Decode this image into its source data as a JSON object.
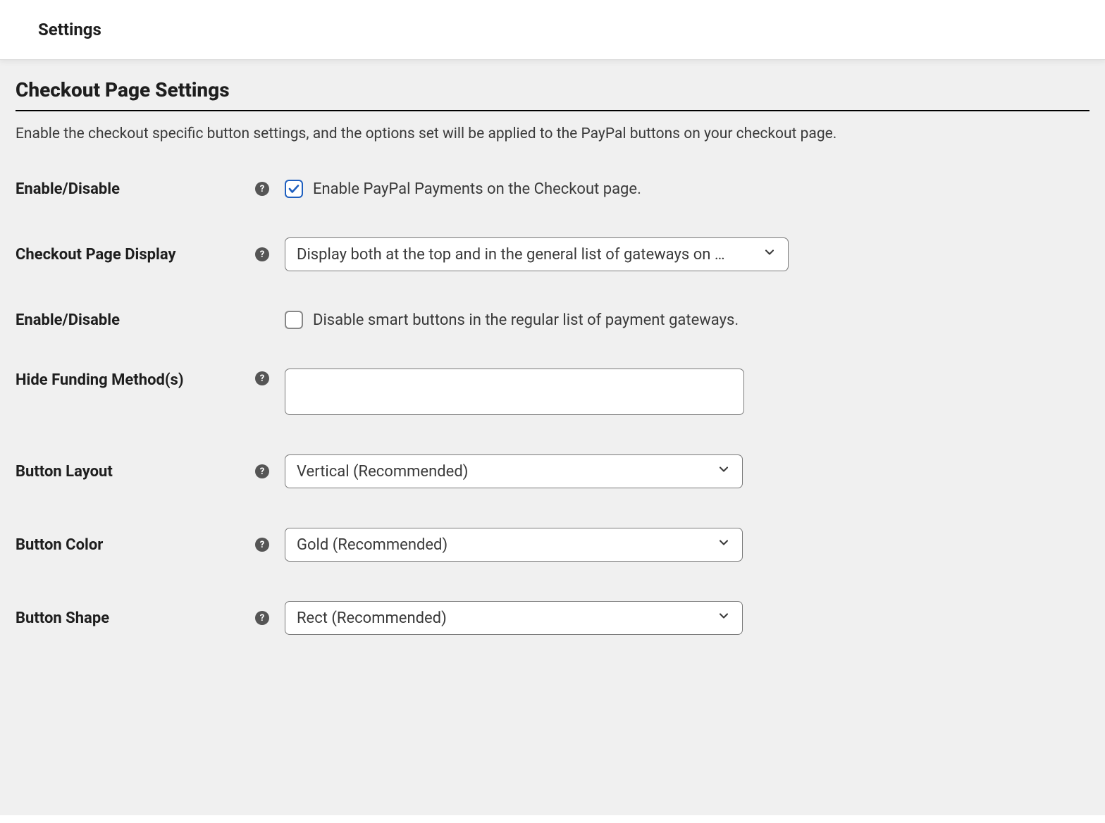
{
  "header": {
    "title": "Settings"
  },
  "section": {
    "title": "Checkout Page Settings",
    "description": "Enable the checkout specific button settings, and the options set will be applied to the PayPal buttons on your checkout page."
  },
  "fields": {
    "enable_checkout": {
      "label": "Enable/Disable",
      "checkbox_label": "Enable PayPal Payments on the Checkout page.",
      "checked": true
    },
    "checkout_display": {
      "label": "Checkout Page Display",
      "value": "Display both at the top and in the general list of gateways on …"
    },
    "disable_smart": {
      "label": "Enable/Disable",
      "checkbox_label": "Disable smart buttons in the regular list of payment gateways.",
      "checked": false
    },
    "hide_funding": {
      "label": "Hide Funding Method(s)",
      "value": ""
    },
    "button_layout": {
      "label": "Button Layout",
      "value": "Vertical (Recommended)"
    },
    "button_color": {
      "label": "Button Color",
      "value": "Gold (Recommended)"
    },
    "button_shape": {
      "label": "Button Shape",
      "value": "Rect (Recommended)"
    }
  }
}
